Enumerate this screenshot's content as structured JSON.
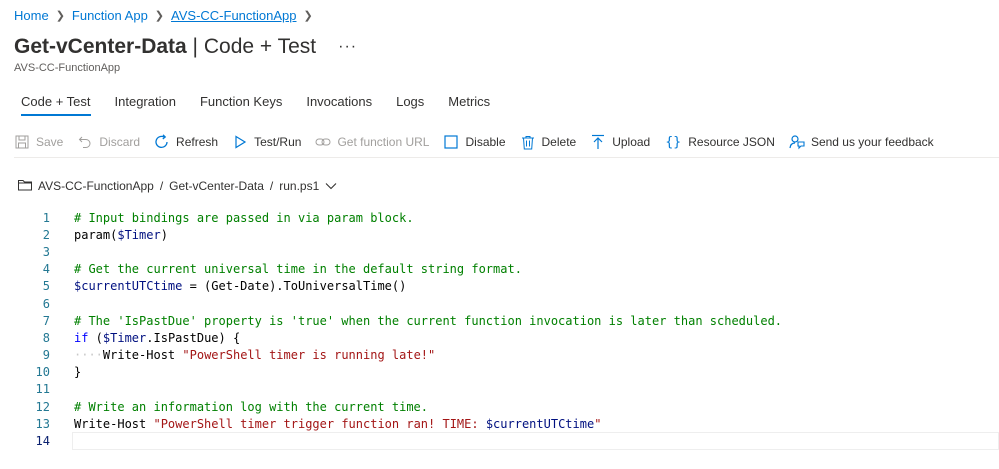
{
  "breadcrumb": {
    "home": "Home",
    "function_app": "Function App",
    "app_name": "AVS-CC-FunctionApp"
  },
  "header": {
    "title_bold": "Get-vCenter-Data",
    "title_rest": " | Code + Test",
    "more": "···",
    "subtitle": "AVS-CC-FunctionApp"
  },
  "tabs": [
    {
      "label": "Code + Test"
    },
    {
      "label": "Integration"
    },
    {
      "label": "Function Keys"
    },
    {
      "label": "Invocations"
    },
    {
      "label": "Logs"
    },
    {
      "label": "Metrics"
    }
  ],
  "toolbar": {
    "save": "Save",
    "discard": "Discard",
    "refresh": "Refresh",
    "test_run": "Test/Run",
    "get_function_url": "Get function URL",
    "disable": "Disable",
    "delete": "Delete",
    "upload": "Upload",
    "resource_json": "Resource JSON",
    "feedback": "Send us your feedback"
  },
  "file_path": {
    "app": "AVS-CC-FunctionApp",
    "function": "Get-vCenter-Data",
    "file": "run.ps1",
    "sep": "/"
  },
  "editor": {
    "line_numbers": [
      "1",
      "2",
      "3",
      "4",
      "5",
      "6",
      "7",
      "8",
      "9",
      "10",
      "11",
      "12",
      "13",
      "14"
    ],
    "lines": {
      "l1": "# Input bindings are passed in via param block.",
      "l2a": "param(",
      "l2b": "$Timer",
      "l2c": ")",
      "l4": "# Get the current universal time in the default string format.",
      "l5a": "$currentUTCtime",
      "l5b": " = (Get-Date).ToUniversalTime()",
      "l7": "# The 'IsPastDue' property is 'true' when the current function invocation is later than scheduled.",
      "l8a": "if",
      "l8b": " (",
      "l8c": "$Timer",
      "l8d": ".IsPastDue) {",
      "l9a": "····",
      "l9b": "Write-Host ",
      "l9c": "\"PowerShell timer is running late!\"",
      "l10": "}",
      "l12": "# Write an information log with the current time.",
      "l13a": "Write-Host ",
      "l13b": "\"PowerShell timer trigger function ran! TIME: ",
      "l13c": "$currentUTCtime",
      "l13d": "\""
    }
  },
  "colors": {
    "accent": "#0078d4",
    "comment": "#008000",
    "string": "#a31515",
    "variable": "#001080",
    "line_number": "#237893"
  }
}
